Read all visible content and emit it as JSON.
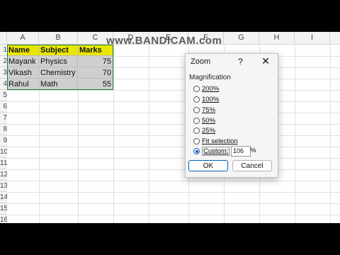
{
  "watermark": "www.BANDICAM.com",
  "columns": [
    "A",
    "B",
    "C",
    "D",
    "E",
    "F",
    "G",
    "H",
    "I"
  ],
  "rows": [
    "1",
    "2",
    "3",
    "4",
    "5",
    "6",
    "7",
    "8",
    "9",
    "10",
    "11",
    "12",
    "13",
    "14",
    "15",
    "16"
  ],
  "table": {
    "headers": [
      "Name",
      "Subject",
      "Marks"
    ],
    "rows": [
      [
        "Mayank",
        "Physics",
        "75"
      ],
      [
        "Vikash",
        "Chemistry",
        "70"
      ],
      [
        "Rahul",
        "Math",
        "55"
      ]
    ]
  },
  "dialog": {
    "title": "Zoom",
    "help": "?",
    "close": "✕",
    "group_label": "Magnification",
    "options": [
      "200%",
      "100%",
      "75%",
      "50%",
      "25%",
      "Fit selection",
      "Custom:"
    ],
    "selected": "Custom:",
    "custom_value": "106",
    "percent_sign": "%",
    "ok": "OK",
    "cancel": "Cancel"
  },
  "colors": {
    "header_fill": "#e9e600",
    "data_fill": "#cfcfcf",
    "selection_border": "#1e7b34",
    "accent": "#0058b8"
  }
}
